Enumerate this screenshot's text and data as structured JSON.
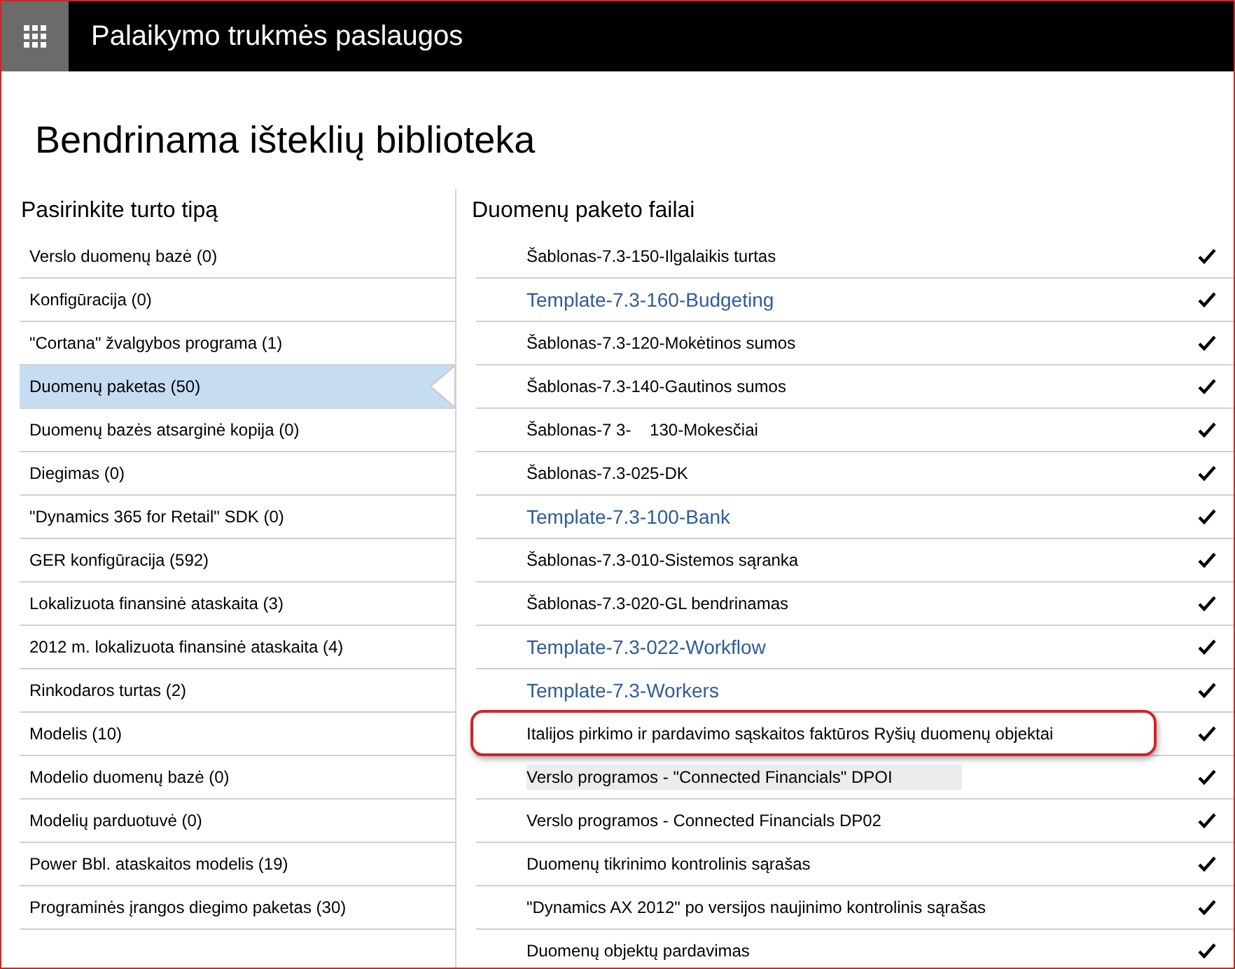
{
  "header": {
    "title": "Palaikymo trukmės paslaugos"
  },
  "page_title": "Bendrinama išteklių biblioteka",
  "asset_types": {
    "heading": "Pasirinkite turto tipą",
    "items": [
      {
        "label": "Verslo duomenų bazė (0)",
        "selected": false
      },
      {
        "label": "Konfigūracija (0)",
        "selected": false
      },
      {
        "label": "\"Cortana\" žvalgybos programa (1)",
        "selected": false
      },
      {
        "label": "Duomenų paketas (50)",
        "selected": true
      },
      {
        "label": "Duomenų bazės atsarginė kopija (0)",
        "selected": false
      },
      {
        "label": "Diegimas (0)",
        "selected": false
      },
      {
        "label": "\"Dynamics 365 for Retail\" SDK (0)",
        "selected": false
      },
      {
        "label": "GER konfigūracija (592)",
        "selected": false
      },
      {
        "label": "Lokalizuota finansinė ataskaita (3)",
        "selected": false
      },
      {
        "label": "2012 m. lokalizuota finansinė ataskaita (4)",
        "selected": false
      },
      {
        "label": "Rinkodaros turtas (2)",
        "selected": false
      },
      {
        "label": "Modelis (10)",
        "selected": false
      },
      {
        "label": "Modelio duomenų bazė (0)",
        "selected": false
      },
      {
        "label": "Modelių parduotuvė (0)",
        "selected": false
      },
      {
        "label": "Power Bbl. ataskaitos modelis (19)",
        "selected": false
      },
      {
        "label": "Programinės įrangos diegimo paketas (30)",
        "selected": false
      }
    ]
  },
  "files": {
    "heading": "Duomenų paketo failai",
    "rows": [
      {
        "name": "Šablonas-7.3-150-Ilgalaikis turtas",
        "kind": "plain",
        "checked": true,
        "highlighted": false,
        "shaded": false
      },
      {
        "name": "Template-7.3-160-Budgeting",
        "kind": "link",
        "checked": true,
        "highlighted": false,
        "shaded": false
      },
      {
        "name": "Šablonas-7.3-120-Mokėtinos sumos",
        "kind": "plain",
        "checked": true,
        "highlighted": false,
        "shaded": false
      },
      {
        "name": "Šablonas-7.3-140-Gautinos sumos",
        "kind": "plain",
        "checked": true,
        "highlighted": false,
        "shaded": false
      },
      {
        "name": "Šablonas-7 3-    130-Mokesčiai",
        "kind": "plain",
        "checked": true,
        "highlighted": false,
        "shaded": false
      },
      {
        "name": "Šablonas-7.3-025-DK",
        "kind": "plain",
        "checked": true,
        "highlighted": false,
        "shaded": false
      },
      {
        "name": "Template-7.3-100-Bank",
        "kind": "link",
        "checked": true,
        "highlighted": false,
        "shaded": false
      },
      {
        "name": "Šablonas-7.3-010-Sistemos sąranka",
        "kind": "plain",
        "checked": true,
        "highlighted": false,
        "shaded": false
      },
      {
        "name": "Šablonas-7.3-020-GL bendrinamas",
        "kind": "plain",
        "checked": true,
        "highlighted": false,
        "shaded": false
      },
      {
        "name": "Template-7.3-022-Workflow",
        "kind": "link",
        "checked": true,
        "highlighted": false,
        "shaded": false
      },
      {
        "name": "Template-7.3-Workers",
        "kind": "link",
        "checked": true,
        "highlighted": false,
        "shaded": false
      },
      {
        "name": "Italijos pirkimo ir pardavimo sąskaitos faktūros Ryšių duomenų objektai",
        "kind": "plain",
        "checked": true,
        "highlighted": true,
        "shaded": false
      },
      {
        "name": "Verslo programos - \"Connected Financials\" DPOI",
        "kind": "plain",
        "checked": true,
        "highlighted": false,
        "shaded": true
      },
      {
        "name": "Verslo programos - Connected Financials DP02",
        "kind": "plain",
        "checked": true,
        "highlighted": false,
        "shaded": false
      },
      {
        "name": "Duomenų tikrinimo kontrolinis sąrašas",
        "kind": "plain",
        "checked": true,
        "highlighted": false,
        "shaded": false
      },
      {
        "name": "\"Dynamics AX 2012\" po versijos naujinimo kontrolinis sąrašas",
        "kind": "plain",
        "checked": true,
        "highlighted": false,
        "shaded": false
      },
      {
        "name": "Duomenų objektų pardavimas",
        "kind": "plain",
        "checked": true,
        "highlighted": false,
        "shaded": false
      }
    ]
  }
}
